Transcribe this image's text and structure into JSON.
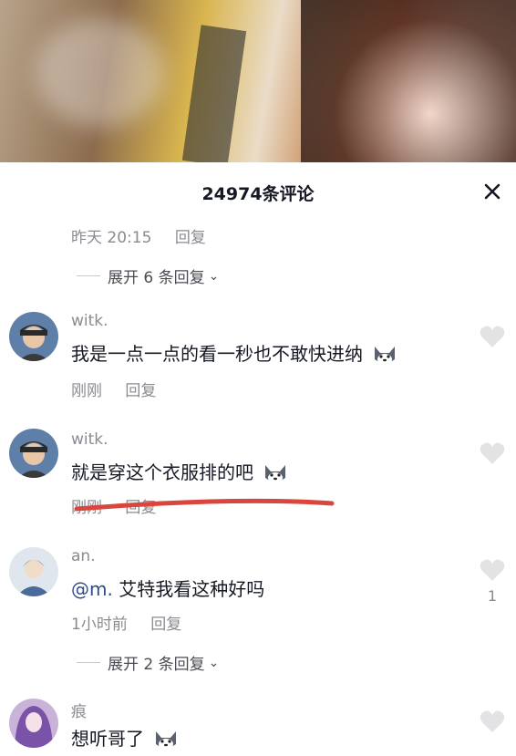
{
  "header": {
    "title": "24974条评论"
  },
  "top_meta": {
    "time": "昨天 20:15",
    "reply": "回复"
  },
  "expand1": {
    "label": "展开 6 条回复"
  },
  "comments": [
    {
      "user": "witk.",
      "text": "我是一点一点的看一秒也不敢快进纳",
      "time": "刚刚",
      "reply": "回复"
    },
    {
      "user": "witk.",
      "text": "就是穿这个衣服排的吧",
      "time": "刚刚",
      "reply": "回复"
    },
    {
      "user": "an.",
      "mention": "@m.",
      "text": " 艾特我看这种好吗",
      "time": "1小时前",
      "reply": "回复",
      "likes": "1"
    },
    {
      "user": "痕",
      "text": "想听哥了"
    }
  ],
  "expand2": {
    "label": "展开 2 条回复"
  },
  "icons": {
    "close": "close-icon",
    "heart": "heart-icon",
    "chevron": "chevron-down-icon",
    "emoji": "dog-emoji-icon"
  },
  "colors": {
    "annotation_underline": "#d9463e",
    "heart": "#e3e3e6"
  }
}
